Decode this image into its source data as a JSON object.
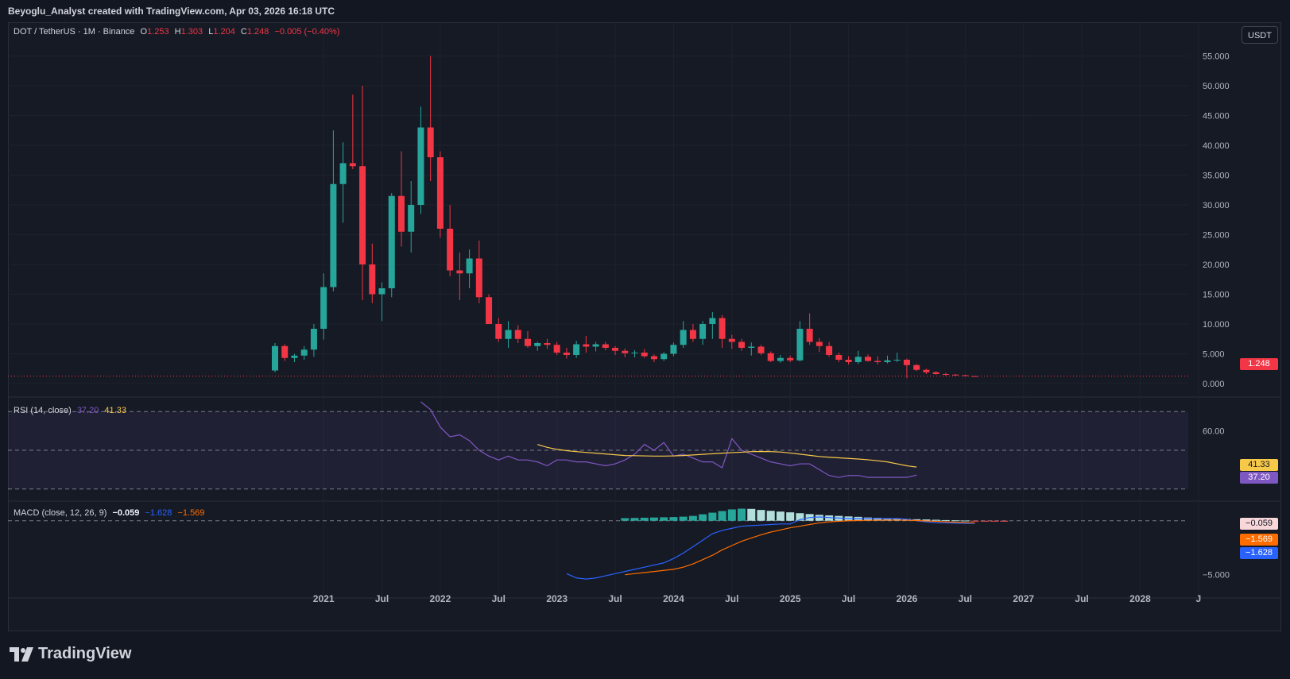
{
  "header": {
    "text": "Beyoglu_Analyst created with TradingView.com, Apr 03, 2026 16:18 UTC"
  },
  "main_legend": {
    "symbol": "DOT / TetherUS · 1M · Binance",
    "o_label": "O",
    "o": "1.253",
    "h_label": "H",
    "h": "1.303",
    "l_label": "L",
    "l": "1.204",
    "c_label": "C",
    "c": "1.248",
    "change": "−0.005 (−0.40%)"
  },
  "rsi_legend": {
    "name": "RSI (14, close)",
    "rsi": "37.20",
    "ma": "41.33"
  },
  "macd_legend": {
    "name": "MACD (close, 12, 26, 9)",
    "hist": "−0.059",
    "macd": "−1.628",
    "signal": "−1.569"
  },
  "currency_button": "USDT",
  "brand": "TradingView",
  "colors": {
    "up": "#26a69a",
    "down": "#f23645",
    "rsi": "#7e57c2",
    "rsi_ma": "#f7c948",
    "macd": "#2962ff",
    "signal": "#ff6d00",
    "bg": "#131722",
    "grid": "#1e222d"
  },
  "chart_data": {
    "type": "candlestick",
    "price": {
      "y_ticks": [
        "0.000",
        "5.000",
        "10.000",
        "15.000",
        "20.000",
        "25.000",
        "30.000",
        "35.000",
        "40.000",
        "45.000",
        "50.000",
        "55.000"
      ],
      "y_tick_values": [
        0,
        5,
        10,
        15,
        20,
        25,
        30,
        35,
        40,
        45,
        50,
        55
      ],
      "ylim": [
        -2,
        58
      ],
      "last_price": "1.248",
      "last_price_value": 1.248
    },
    "x_ticks": [
      "2021",
      "Jul",
      "2022",
      "Jul",
      "2023",
      "Jul",
      "2024",
      "Jul",
      "2025",
      "Jul",
      "2026",
      "Jul",
      "2027",
      "Jul",
      "2028",
      "J"
    ],
    "x_tick_index": [
      5,
      11,
      17,
      23,
      29,
      35,
      41,
      47,
      53,
      59,
      65,
      71,
      77,
      83,
      89,
      95
    ],
    "candles": [
      [
        2.2,
        6.8,
        1.9,
        6.3
      ],
      [
        6.3,
        6.6,
        3.8,
        4.3
      ],
      [
        4.3,
        5.0,
        3.6,
        4.7
      ],
      [
        4.7,
        6.3,
        4.0,
        5.7
      ],
      [
        5.7,
        10.0,
        4.5,
        9.2
      ],
      [
        9.2,
        18.5,
        7.4,
        16.2
      ],
      [
        16.2,
        42.5,
        15.5,
        33.5
      ],
      [
        33.5,
        40.5,
        27.0,
        37.0
      ],
      [
        37.0,
        48.5,
        36.0,
        36.5
      ],
      [
        36.5,
        50.0,
        14.0,
        20.0
      ],
      [
        20.0,
        23.5,
        13.5,
        15.0
      ],
      [
        15.0,
        17.0,
        10.5,
        16.0
      ],
      [
        16.0,
        32.0,
        14.5,
        31.5
      ],
      [
        31.5,
        39.0,
        23.0,
        25.5
      ],
      [
        25.5,
        34.0,
        22.0,
        30.0
      ],
      [
        30.0,
        46.5,
        28.5,
        43.0
      ],
      [
        43.0,
        55.0,
        34.0,
        38.0
      ],
      [
        38.0,
        39.0,
        24.5,
        26.0
      ],
      [
        26.0,
        30.0,
        18.0,
        19.0
      ],
      [
        19.0,
        22.0,
        14.0,
        18.5
      ],
      [
        18.5,
        22.5,
        16.0,
        21.0
      ],
      [
        21.0,
        24.0,
        13.5,
        14.5
      ],
      [
        14.5,
        15.0,
        10.5,
        10.0
      ],
      [
        10.0,
        11.0,
        7.0,
        7.5
      ],
      [
        7.5,
        10.5,
        6.0,
        9.0
      ],
      [
        9.0,
        9.8,
        6.8,
        7.5
      ],
      [
        7.5,
        8.8,
        6.0,
        6.3
      ],
      [
        6.3,
        7.0,
        5.5,
        6.8
      ],
      [
        6.8,
        7.5,
        5.8,
        6.5
      ],
      [
        6.5,
        7.0,
        4.8,
        5.2
      ],
      [
        5.2,
        6.0,
        4.2,
        4.8
      ],
      [
        4.8,
        7.2,
        4.3,
        6.6
      ],
      [
        6.6,
        8.0,
        5.2,
        6.2
      ],
      [
        6.2,
        7.0,
        5.4,
        6.6
      ],
      [
        6.6,
        7.0,
        5.6,
        6.0
      ],
      [
        6.0,
        6.3,
        4.8,
        5.5
      ],
      [
        5.5,
        5.9,
        4.4,
        5.1
      ],
      [
        5.1,
        5.6,
        4.4,
        5.2
      ],
      [
        5.2,
        5.8,
        4.3,
        4.6
      ],
      [
        4.6,
        4.9,
        3.6,
        4.1
      ],
      [
        4.1,
        5.3,
        3.8,
        5.0
      ],
      [
        5.0,
        6.9,
        4.6,
        6.5
      ],
      [
        6.5,
        10.5,
        6.0,
        9.0
      ],
      [
        9.0,
        10.0,
        7.0,
        7.5
      ],
      [
        7.5,
        10.5,
        6.5,
        10.0
      ],
      [
        10.0,
        12.0,
        7.5,
        11.0
      ],
      [
        11.0,
        11.5,
        6.0,
        7.5
      ],
      [
        7.5,
        8.2,
        5.8,
        7.0
      ],
      [
        7.0,
        7.5,
        5.5,
        6.0
      ],
      [
        6.0,
        6.9,
        4.7,
        6.2
      ],
      [
        6.2,
        6.5,
        4.8,
        5.1
      ],
      [
        5.1,
        5.4,
        3.6,
        3.8
      ],
      [
        3.8,
        4.8,
        3.5,
        4.3
      ],
      [
        4.3,
        4.7,
        3.6,
        3.9
      ],
      [
        3.9,
        10.5,
        3.7,
        9.2
      ],
      [
        9.2,
        11.8,
        6.5,
        7.0
      ],
      [
        7.0,
        7.6,
        5.3,
        6.3
      ],
      [
        6.3,
        7.0,
        4.5,
        4.8
      ],
      [
        4.8,
        5.2,
        3.6,
        4.0
      ],
      [
        4.0,
        4.6,
        3.2,
        3.6
      ],
      [
        3.6,
        5.5,
        3.3,
        4.5
      ],
      [
        4.5,
        4.9,
        3.7,
        3.8
      ],
      [
        3.8,
        4.6,
        3.2,
        3.6
      ],
      [
        3.6,
        4.7,
        3.4,
        3.9
      ],
      [
        3.9,
        5.2,
        3.6,
        4.0
      ],
      [
        4.0,
        4.2,
        0.9,
        3.1
      ],
      [
        3.1,
        3.3,
        2.1,
        2.3
      ],
      [
        2.3,
        2.5,
        1.6,
        1.9
      ],
      [
        1.9,
        2.1,
        1.5,
        1.6
      ],
      [
        1.6,
        1.8,
        1.3,
        1.5
      ],
      [
        1.5,
        1.6,
        1.3,
        1.4
      ],
      [
        1.4,
        1.5,
        1.2,
        1.3
      ],
      [
        1.253,
        1.303,
        1.204,
        1.248
      ]
    ],
    "rsi": {
      "y_ticks": [
        "60.00"
      ],
      "y_tick_values": [
        60
      ],
      "upper": 70,
      "mid": 50,
      "lower": 30,
      "ylim": [
        25,
        75
      ],
      "start_index": 15,
      "values": [
        75,
        71,
        62,
        57,
        58,
        55,
        50,
        47,
        45,
        47,
        45,
        45,
        44,
        42,
        45,
        45,
        44,
        44,
        43,
        42,
        43,
        45,
        48,
        53,
        50,
        54,
        47,
        48,
        46,
        44,
        44,
        41,
        56,
        50,
        48,
        46,
        44,
        43,
        42,
        43,
        43,
        40,
        37,
        36,
        37,
        37,
        36,
        36,
        36,
        36,
        36,
        37.2
      ],
      "ma_start_index": 27,
      "ma_values": [
        53.0,
        51.5,
        50.5,
        49.8,
        49.3,
        48.9,
        48.5,
        48.1,
        47.7,
        47.3,
        47.2,
        47.1,
        47.0,
        47.0,
        47.1,
        47.3,
        47.6,
        47.9,
        48.2,
        48.5,
        48.8,
        49.0,
        49.3,
        49.4,
        49.3,
        49.1,
        48.6,
        48.0,
        47.4,
        46.8,
        46.4,
        46.1,
        45.8,
        45.5,
        45.1,
        44.6,
        44.0,
        43.0,
        42.0,
        41.33
      ]
    },
    "macd": {
      "y_ticks": [
        "−5.000"
      ],
      "y_tick_values": [
        -5
      ],
      "ylim": [
        -6.2,
        1.6
      ],
      "line_start_index": 30,
      "macd_values": [
        -4.9,
        -5.3,
        -5.4,
        -5.3,
        -5.1,
        -4.9,
        -4.7,
        -4.5,
        -4.3,
        -4.1,
        -3.9,
        -3.5,
        -3.0,
        -2.4,
        -1.8,
        -1.2,
        -0.9,
        -0.7,
        -0.5,
        -0.45,
        -0.4,
        -0.35,
        -0.3,
        -0.3,
        0.1,
        0.3,
        0.35,
        0.3,
        0.25,
        0.2,
        0.2,
        0.2,
        0.2,
        0.2,
        0.2,
        0.15,
        0.0,
        -0.1,
        -0.18,
        -0.2,
        -0.22,
        -0.24,
        -0.24
      ],
      "signal_start_index": 36,
      "signal_values": [
        -5.0,
        -4.9,
        -4.8,
        -4.7,
        -4.6,
        -4.5,
        -4.3,
        -4.0,
        -3.6,
        -3.2,
        -2.7,
        -2.3,
        -1.9,
        -1.6,
        -1.3,
        -1.05,
        -0.85,
        -0.65,
        -0.5,
        -0.35,
        -0.2,
        -0.1,
        -0.05,
        0.0,
        0.02,
        0.04,
        0.05,
        0.06,
        0.06,
        0.05,
        0.02,
        -0.02,
        -0.06,
        -0.1,
        -0.13,
        -0.16,
        -0.2
      ],
      "hist_start_index": 36,
      "hist_values": [
        0.24,
        0.26,
        0.28,
        0.3,
        0.32,
        0.34,
        0.38,
        0.45,
        0.6,
        0.75,
        0.9,
        1.05,
        1.12,
        1.1,
        1.0,
        0.92,
        0.85,
        0.78,
        0.7,
        0.62,
        0.55,
        0.5,
        0.45,
        0.4,
        0.36,
        0.3,
        0.27,
        0.24,
        0.2,
        0.17,
        0.14,
        0.12,
        0.09,
        0.06,
        0.04,
        0.02,
        -0.02,
        -0.04,
        -0.05,
        -0.059
      ]
    }
  }
}
